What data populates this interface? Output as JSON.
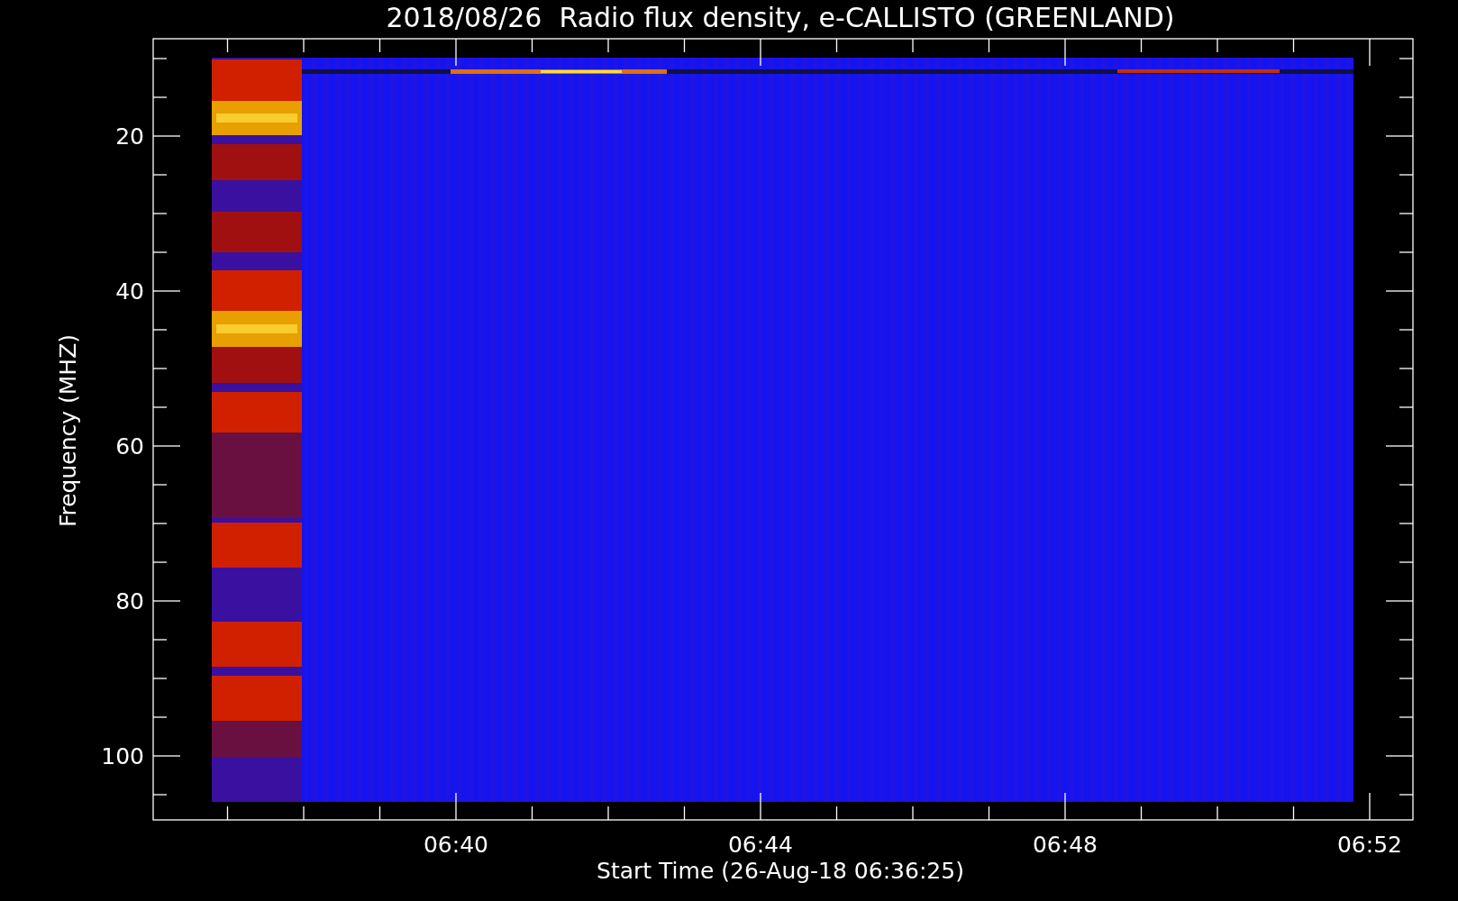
{
  "plot": {
    "title": "2018/08/26  Radio flux density, e-CALLISTO (GREENLAND)",
    "ylabel": "Frequency (MHZ)",
    "xlabel": "Start Time (26-Aug-18 06:36:25)",
    "y_tick_labels": [
      "20",
      "40",
      "60",
      "80",
      "100"
    ],
    "x_tick_labels": [
      "06:40",
      "06:44",
      "06:48",
      "06:52"
    ]
  }
}
